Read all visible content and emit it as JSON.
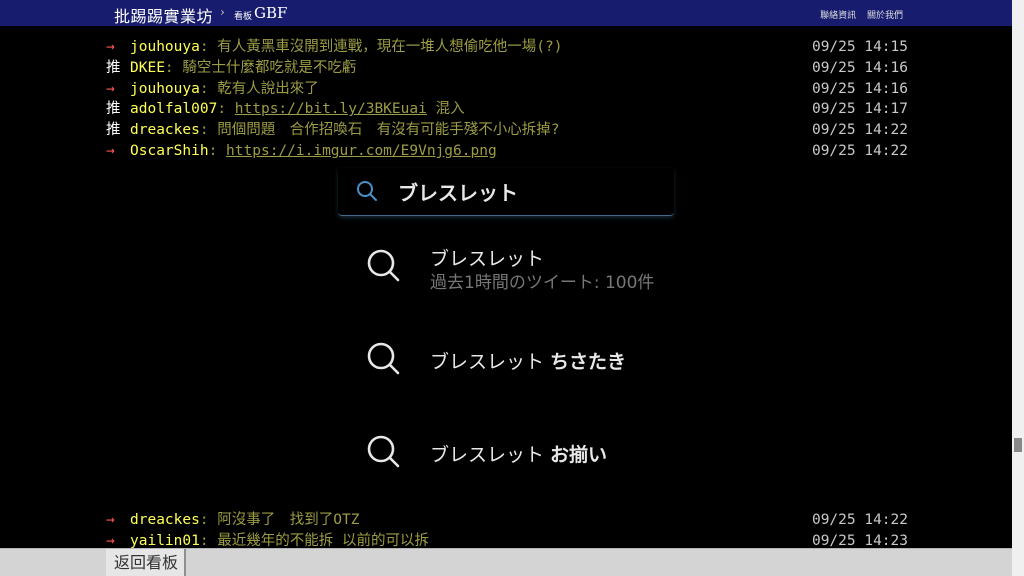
{
  "header": {
    "site_title": "批踢踢實業坊",
    "breadcrumb_arrow": "›",
    "board_label": "看板",
    "board_name": "GBF",
    "link_contact": "聯絡資訊",
    "link_about": "關於我們"
  },
  "pushes_top": [
    {
      "tag": "→",
      "user": "jouhouya",
      "content": ": 有人黃黑車沒開到連戰，現在一堆人想偷吃他一場(?)",
      "link": "",
      "after": "",
      "time": "09/25 14:15"
    },
    {
      "tag": "推",
      "user": "DKEE",
      "content": ": 騎空士什麼都吃就是不吃虧",
      "link": "",
      "after": "",
      "time": "09/25 14:16"
    },
    {
      "tag": "→",
      "user": "jouhouya",
      "content": ": 乾有人說出來了",
      "link": "",
      "after": "",
      "time": "09/25 14:16"
    },
    {
      "tag": "推",
      "user": "adolfal007",
      "content": ": ",
      "link": "https://bit.ly/3BKEuai",
      "after": " 混入",
      "time": "09/25 14:17"
    },
    {
      "tag": "推",
      "user": "dreackes",
      "content": ": 問個問題　合作招喚石　有沒有可能手殘不小心拆掉?",
      "link": "",
      "after": "",
      "time": "09/25 14:22"
    },
    {
      "tag": "→",
      "user": "OscarShih",
      "content": ": ",
      "link": "https://i.imgur.com/E9Vnjg6.png",
      "after": "",
      "time": "09/25 14:22"
    }
  ],
  "pushes_bottom": [
    {
      "tag": "→",
      "user": "dreackes",
      "content": ": 阿沒事了　找到了OTZ",
      "link": "",
      "after": "",
      "time": "09/25 14:22"
    },
    {
      "tag": "→",
      "user": "yailin01",
      "content": ": 最近幾年的不能拆 以前的可以拆",
      "link": "",
      "after": "",
      "time": "09/25 14:23"
    }
  ],
  "search": {
    "query": "ブレスレット",
    "suggestions": [
      {
        "main": "ブレスレット",
        "bold": "",
        "sub": "過去1時間のツイート: 100件"
      },
      {
        "main": "ブレスレット ",
        "bold": "ちさたき",
        "sub": ""
      },
      {
        "main": "ブレスレット ",
        "bold": "お揃い",
        "sub": ""
      }
    ]
  },
  "footer": {
    "back_label": "返回看板"
  },
  "colors": {
    "topbar_bg": "#171c6e",
    "user": "#ffff55",
    "content": "#9c9c44",
    "arrow": "#ff5555",
    "search_accent": "#3f6a8a"
  }
}
